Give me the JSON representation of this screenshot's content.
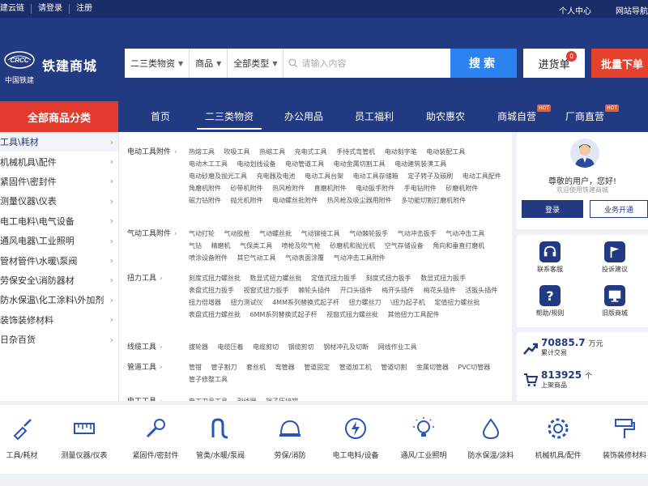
{
  "topbar": {
    "left": [
      "建云链",
      "请登录",
      "注册"
    ],
    "right": [
      "个人中心",
      "网站导航"
    ]
  },
  "header": {
    "logo_abbr": "CRCC",
    "logo_sub": "中国铁建",
    "brand": "铁建商城",
    "search": {
      "selects": [
        "二三类物资",
        "商品",
        "全部类型"
      ],
      "placeholder": "请输入内容",
      "button": "搜索"
    },
    "cart": {
      "label": "进货单",
      "count": "0"
    },
    "bulk": "批量下单"
  },
  "nav": {
    "all_categories": "全部商品分类",
    "items": [
      {
        "label": "首页",
        "active": false,
        "hot": ""
      },
      {
        "label": "二三类物资",
        "active": true,
        "hot": ""
      },
      {
        "label": "办公用品",
        "active": false,
        "hot": ""
      },
      {
        "label": "员工福利",
        "active": false,
        "hot": ""
      },
      {
        "label": "助农惠农",
        "active": false,
        "hot": ""
      },
      {
        "label": "商城自营",
        "active": false,
        "hot": "HOT"
      },
      {
        "label": "厂商直营",
        "active": false,
        "hot": "HOT"
      }
    ]
  },
  "left_menu": [
    "工具\\耗材",
    "机械机具\\配件",
    "紧固件\\密封件",
    "测量仪器\\仪表",
    "电工电料\\电气设备",
    "通风电器\\工业照明",
    "管材管件\\水暖\\泵阀",
    "劳保安全\\消防器材",
    "防水保温\\化工涂料\\外加剂",
    "装饰装修材料",
    "日杂百货"
  ],
  "mega": [
    {
      "title": "电动工具附件",
      "items": [
        "热熔工具",
        "吹吸工具",
        "热缩工具",
        "充电式工具",
        "手持式弯管机",
        "电动刻字笔",
        "电动装配工具",
        "电动木工工具",
        "电动划线设备",
        "电动管道工具",
        "电动金属切割工具",
        "电动建筑装潢工具",
        "电动砂磨及抛光工具",
        "充电器及电池",
        "电动工具台架",
        "电动工具存储箱",
        "定子转子及碳刷",
        "电动工具配件",
        "角磨机附件",
        "砂带机附件",
        "热风枪附件",
        "直磨机附件",
        "电动扳手附件",
        "手电钻附件",
        "砂磨机附件",
        "磁力钻附件",
        "抛光机附件",
        "电动螺丝批附件",
        "热风枪及吸尘器用附件",
        "多功能切割打磨机附件"
      ]
    },
    {
      "title": "气动工具附件",
      "items": [
        "气动打轮",
        "气动胶枪",
        "气动螺丝批",
        "气动铆接工具",
        "气动棘轮扳手",
        "气动冲击扳手",
        "气动冲击工具",
        "气钻",
        "精磨机",
        "气保类工具",
        "喷枪及吹气枪",
        "砂磨机和抛光机",
        "空气存储设备",
        "角向和垂直打磨机",
        "喷涂设备附件",
        "其它气动工具",
        "气动表面涂覆",
        "气动冲击工具附件"
      ]
    },
    {
      "title": "扭力工具",
      "items": [
        "刻度式扭力螺丝批",
        "数显式扭力螺丝批",
        "定值式扭力扳手",
        "刻度式扭力扳手",
        "数显式扭力扳手",
        "表盘式扭力扳手",
        "视窗式扭力扳手",
        "棘轮头插件",
        "开口头插件",
        "梅开头插件",
        "梅花头插件",
        "活扳头插件",
        "扭力倍增器",
        "扭力测试仪",
        "4MM系列替换式起子杆",
        "扭力螺丝刀",
        "\\扭力起子机",
        "定值扭力螺丝批",
        "表盘式扭力螺丝批",
        "6MM系列替换式起子杆",
        "视窗式扭力螺丝批",
        "其他扭力工具配件"
      ]
    },
    {
      "title": "线缆工具",
      "items": [
        "拔轮器",
        "电缆压着",
        "电缆剪切",
        "钢缆剪切",
        "钢材冲孔及切断",
        "网线作业工具"
      ]
    },
    {
      "title": "管道工具",
      "items": [
        "管钳",
        "管子割刀",
        "套丝机",
        "弯管器",
        "管道固定",
        "管道加工机",
        "管道切割",
        "金属切管器",
        "PVC切管器",
        "管子修整工具"
      ]
    },
    {
      "title": "电工工具",
      "items": [
        "电工刀具工具",
        "剥线器",
        "端子压接钳"
      ]
    }
  ],
  "user": {
    "greeting": "尊敬的用户，您好!",
    "welcome": "欢迎使用铁建商城",
    "login": "登录",
    "business": "业务开通"
  },
  "tools": [
    {
      "label": "联系客服",
      "icon": "headset-icon"
    },
    {
      "label": "投诉建议",
      "icon": "flag-icon"
    },
    {
      "label": "帮助/规则",
      "icon": "question-icon"
    },
    {
      "label": "旧版商城",
      "icon": "monitor-icon"
    }
  ],
  "stats": [
    {
      "value": "70885.7",
      "unit": "万元",
      "label": "累计交易"
    },
    {
      "value": "813925",
      "unit": "个",
      "label": "上架商品"
    }
  ],
  "bottom_categories": [
    {
      "label": "工具/耗材",
      "icon": "trowel-icon"
    },
    {
      "label": "测量仪器/仪表",
      "icon": "ruler-icon"
    },
    {
      "label": "紧固件/密封件",
      "icon": "wrench-icon"
    },
    {
      "label": "管类/水暖/泵阀",
      "icon": "pipe-icon"
    },
    {
      "label": "劳保/消防",
      "icon": "helmet-icon"
    },
    {
      "label": "电工电料/设备",
      "icon": "bolt-icon"
    },
    {
      "label": "通风/工业照明",
      "icon": "bulb-icon"
    },
    {
      "label": "防水保温/涂料",
      "icon": "drop-icon"
    },
    {
      "label": "机械机具/配件",
      "icon": "gear-icon"
    },
    {
      "label": "装饰装修材料",
      "icon": "roller-icon"
    }
  ],
  "colors": {
    "primary": "#213a82",
    "accent_red": "#e23a2d",
    "search_blue": "#2b82f0"
  }
}
